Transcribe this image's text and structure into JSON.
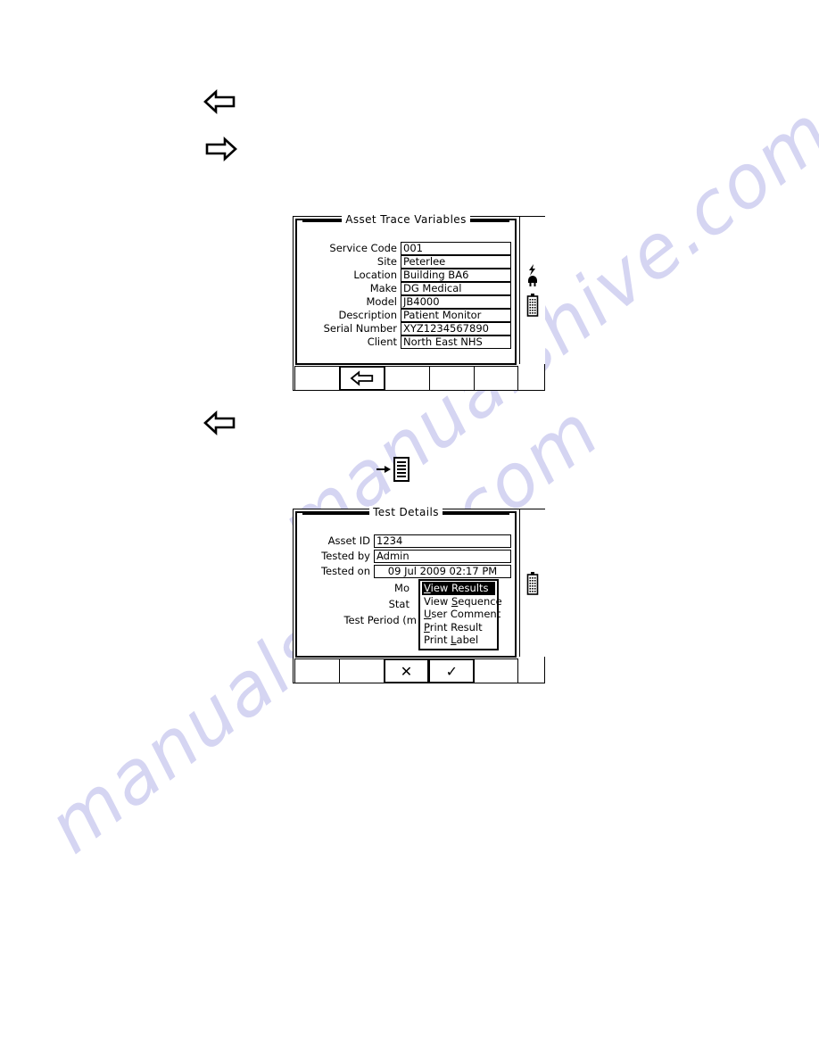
{
  "page": {
    "watermark_text": "manualshive.com"
  },
  "margin_glyphs": [
    {
      "name": "left-arrow-glyph-1",
      "direction": "left"
    },
    {
      "name": "right-arrow-glyph-1",
      "direction": "right"
    },
    {
      "name": "left-arrow-glyph-2",
      "direction": "left"
    }
  ],
  "doc_icon": {
    "name": "arrow-to-document-icon",
    "arrow": "→",
    "label": "document-list-icon"
  },
  "screen_one": {
    "title": "Asset Trace Variables",
    "fields": [
      {
        "label": "Service Code",
        "value": "001"
      },
      {
        "label": "Site",
        "value": "Peterlee"
      },
      {
        "label": "Location",
        "value": "Building BA6"
      },
      {
        "label": "Make",
        "value": "DG Medical"
      },
      {
        "label": "Model",
        "value": "JB4000"
      },
      {
        "label": "Description",
        "value": "Patient Monitor"
      },
      {
        "label": "Serial Number",
        "value": "XYZ1234567890"
      },
      {
        "label": "Client",
        "value": "North East NHS"
      }
    ],
    "status_icons": [
      {
        "name": "mains-power-plug-icon",
        "glyph": "plug"
      },
      {
        "name": "battery-icon",
        "glyph": "battery"
      }
    ],
    "softkeys": [
      {
        "name": "softkey-1",
        "label": "",
        "raised": false
      },
      {
        "name": "softkey-back",
        "label": "←",
        "raised": true
      },
      {
        "name": "softkey-3",
        "label": "",
        "raised": false
      },
      {
        "name": "softkey-4",
        "label": "",
        "raised": false
      },
      {
        "name": "softkey-5",
        "label": "",
        "raised": false
      }
    ]
  },
  "screen_two": {
    "title": "Test Details",
    "fields": [
      {
        "label": "Asset ID",
        "value": "1234"
      },
      {
        "label": "Tested by",
        "value": "Admin"
      },
      {
        "label": "Tested on",
        "value": "09 Jul 2009 02:17 PM"
      },
      {
        "label": "Mo",
        "value": ""
      },
      {
        "label": "Stat",
        "value": ""
      },
      {
        "label": "Test Period (m",
        "value": ""
      }
    ],
    "menu": {
      "name": "test-details-context-menu",
      "items": [
        {
          "label": "View Results",
          "accel": "V",
          "selected": true
        },
        {
          "label": "View Sequence",
          "accel": "S",
          "selected": false
        },
        {
          "label": "User Comment",
          "accel": "U",
          "selected": false
        },
        {
          "label": "Print Result",
          "accel": "P",
          "selected": false
        },
        {
          "label": "Print Label",
          "accel": "L",
          "selected": false
        }
      ]
    },
    "status_icons": [
      {
        "name": "battery-icon",
        "glyph": "battery"
      }
    ],
    "softkeys": [
      {
        "name": "softkey-1",
        "label": "",
        "raised": false
      },
      {
        "name": "softkey-2",
        "label": "",
        "raised": false
      },
      {
        "name": "softkey-cancel",
        "label": "✕",
        "raised": true
      },
      {
        "name": "softkey-confirm",
        "label": "✓",
        "raised": true
      },
      {
        "name": "softkey-5",
        "label": "",
        "raised": false
      }
    ]
  },
  "colors": {
    "ink": "#000000",
    "paper": "#ffffff",
    "watermark": "#d5d5f2"
  }
}
